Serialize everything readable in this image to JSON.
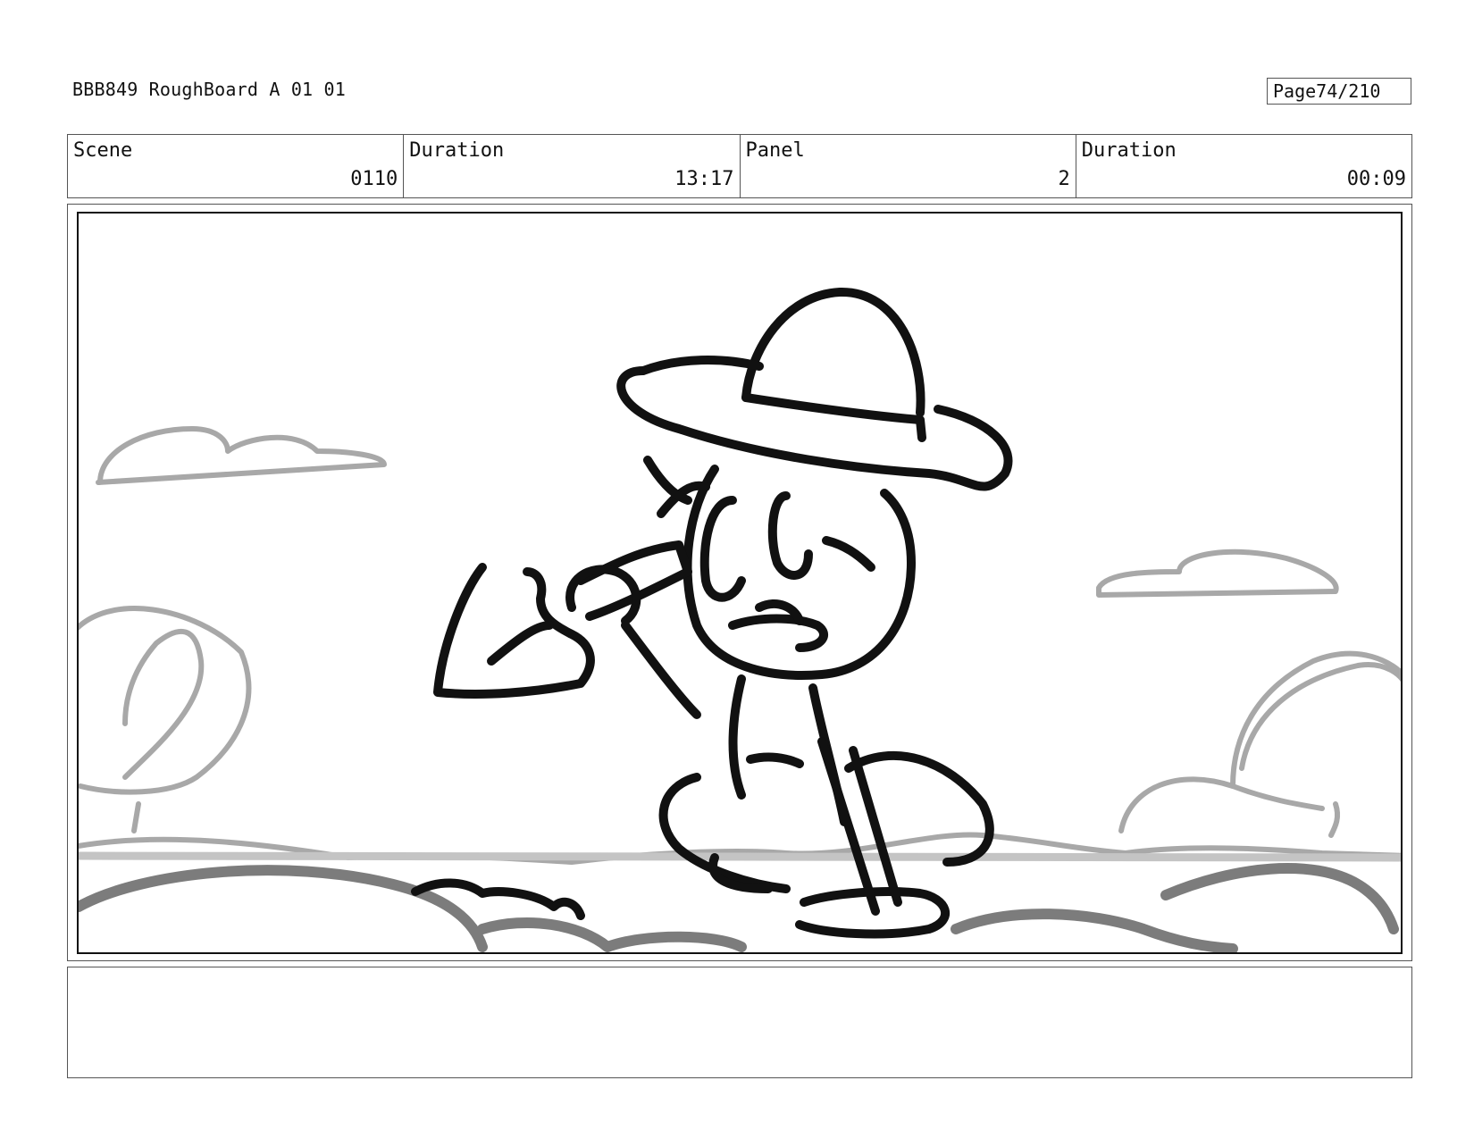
{
  "header": {
    "title": "BBB849 RoughBoard A 01 01",
    "page_label": "Page",
    "page_value": "74/210"
  },
  "info": {
    "scene_label": "Scene",
    "scene_value": "0110",
    "scene_duration_label": "Duration",
    "scene_duration_value": "13:17",
    "panel_label": "Panel",
    "panel_value": "2",
    "panel_duration_label": "Duration",
    "panel_duration_value": "00:09"
  },
  "panel": {
    "drawing": "rough-sketch-cowboy-with-shovel",
    "colors": {
      "ink": "#111111",
      "background_ink": "#a8a8a8",
      "midground_ink": "#7c7c7c",
      "paper": "#ffffff"
    }
  },
  "notes": {
    "text": ""
  }
}
